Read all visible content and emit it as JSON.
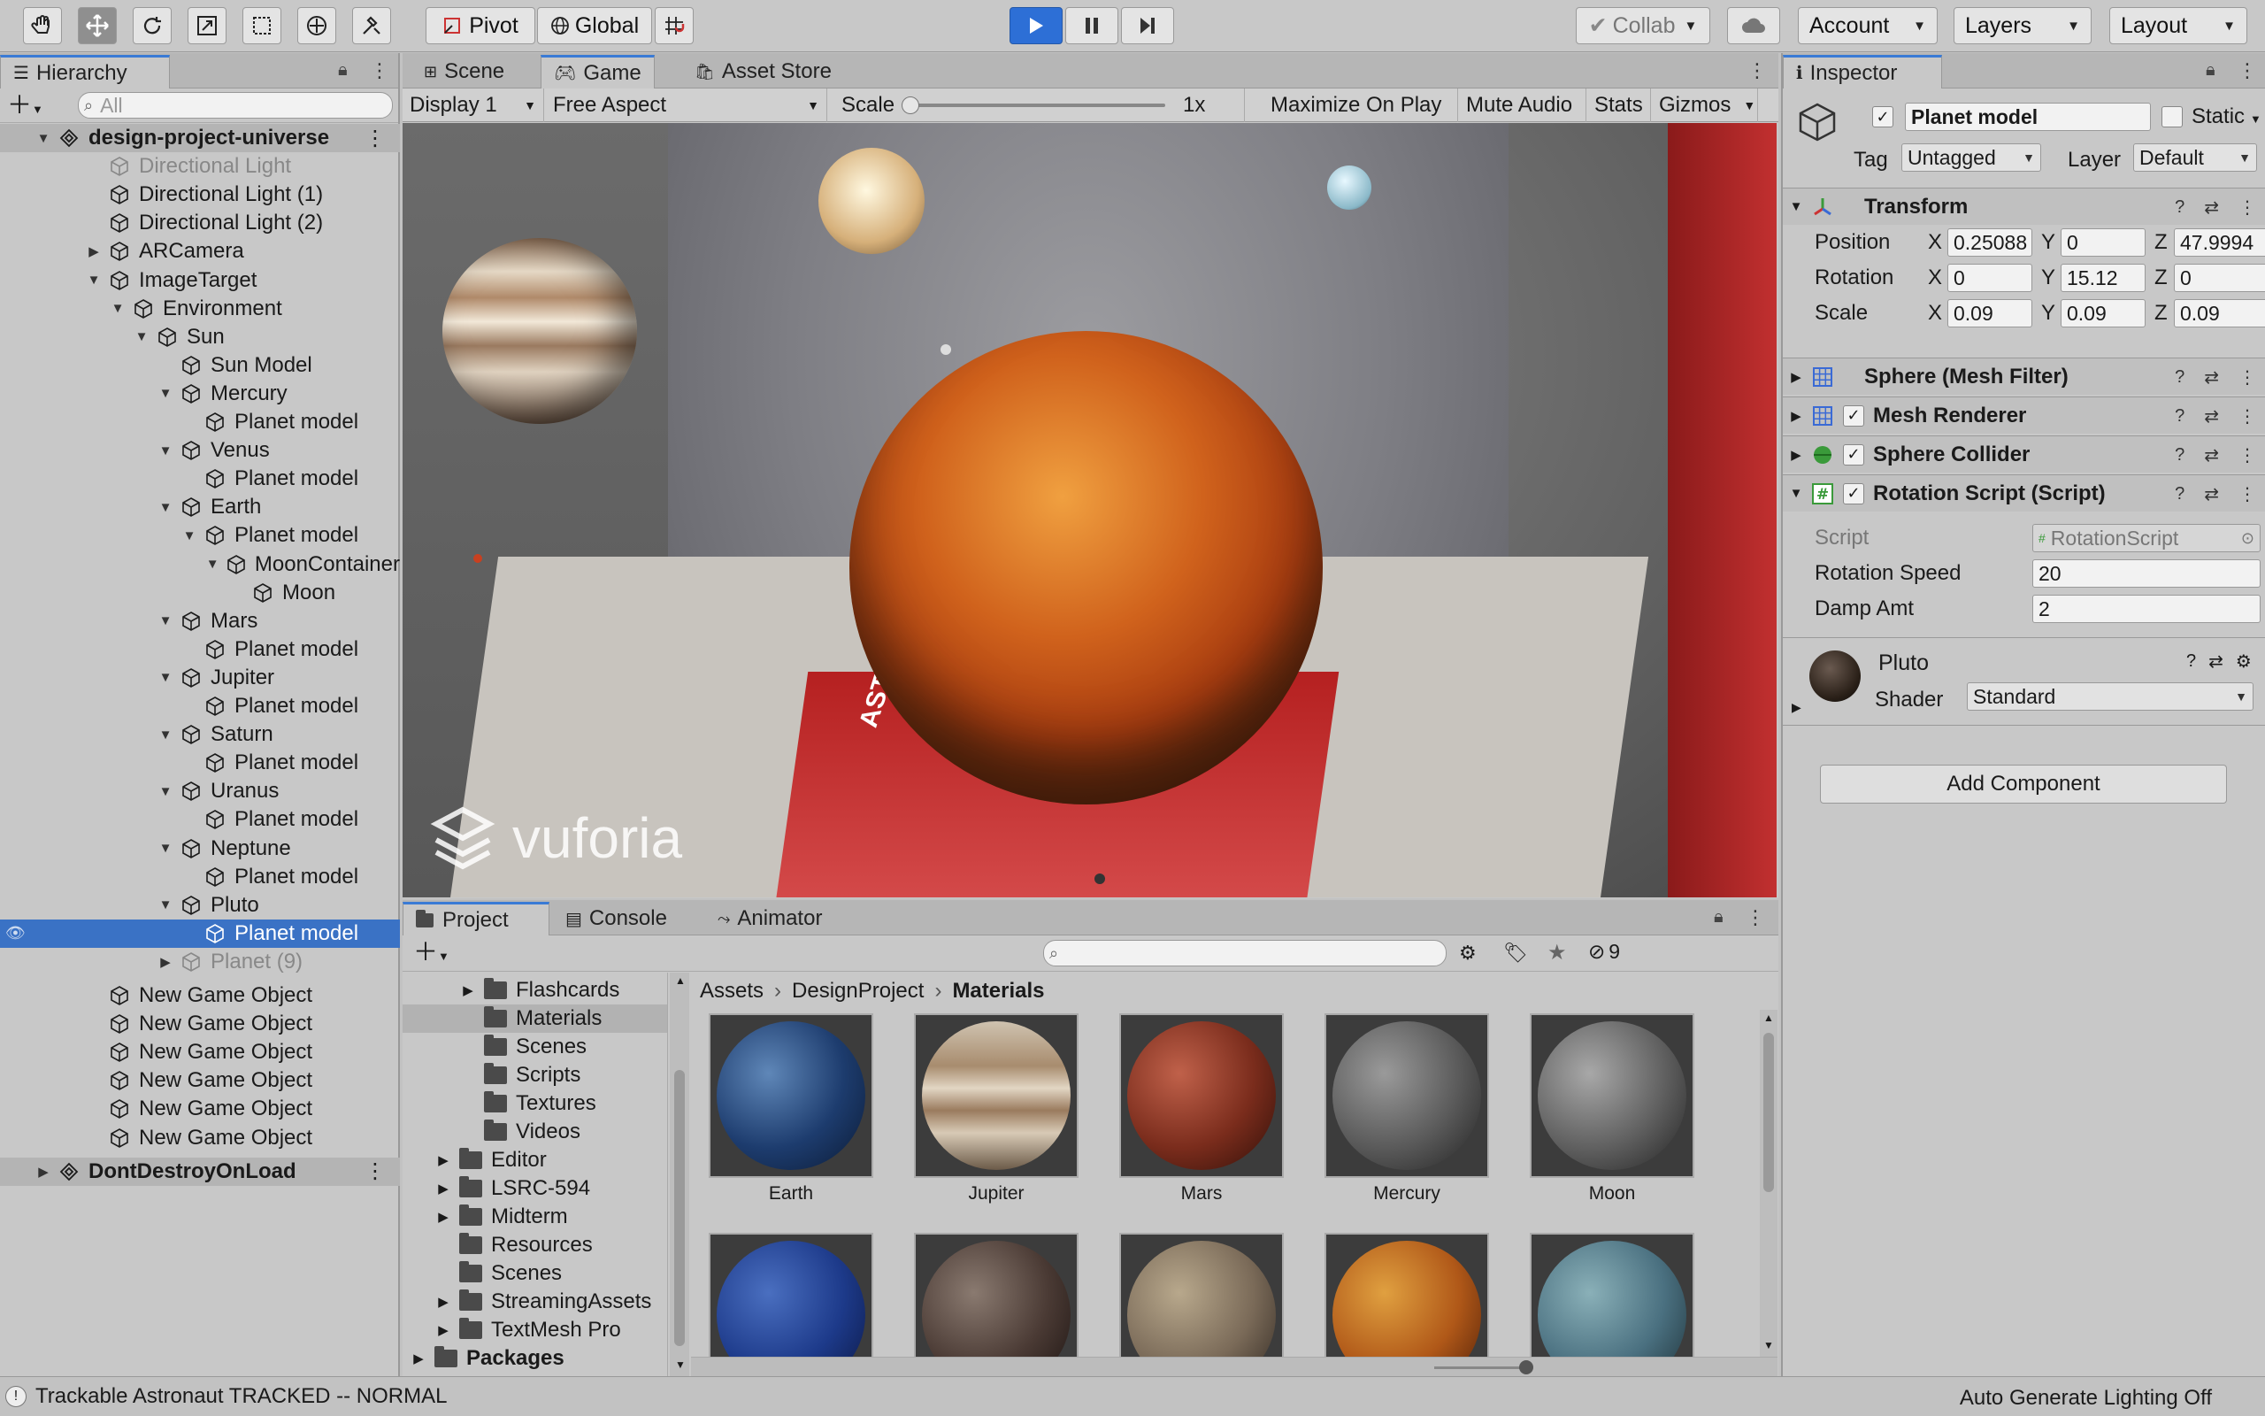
{
  "toolbar": {
    "pivot_label": "Pivot",
    "global_label": "Global",
    "collab_label": "Collab",
    "account_label": "Account",
    "layers_label": "Layers",
    "layout_label": "Layout"
  },
  "hierarchy": {
    "tab_label": "Hierarchy",
    "search_placeholder": "All",
    "items": [
      {
        "label": "design-project-universe",
        "indent": 0,
        "arrow": "▼",
        "icon": "unity-scene-icon",
        "style": "scene"
      },
      {
        "label": "Directional Light",
        "indent": 1,
        "arrow": "",
        "icon": "cube-icon",
        "style": "dim"
      },
      {
        "label": "Directional Light (1)",
        "indent": 1,
        "arrow": "",
        "icon": "cube-icon",
        "style": ""
      },
      {
        "label": "Directional Light (2)",
        "indent": 1,
        "arrow": "",
        "icon": "cube-icon",
        "style": ""
      },
      {
        "label": "ARCamera",
        "indent": 1,
        "arrow": "▶",
        "icon": "cube-icon",
        "style": ""
      },
      {
        "label": "ImageTarget",
        "indent": 1,
        "arrow": "▼",
        "icon": "cube-icon",
        "style": ""
      },
      {
        "label": "Environment",
        "indent": 2,
        "arrow": "▼",
        "icon": "cube-icon",
        "style": ""
      },
      {
        "label": "Sun",
        "indent": 3,
        "arrow": "▼",
        "icon": "cube-icon",
        "style": ""
      },
      {
        "label": "Sun Model",
        "indent": 4,
        "arrow": "",
        "icon": "cube-icon",
        "style": ""
      },
      {
        "label": "Mercury",
        "indent": 4,
        "arrow": "▼",
        "icon": "cube-icon",
        "style": ""
      },
      {
        "label": "Planet model",
        "indent": 5,
        "arrow": "",
        "icon": "cube-icon",
        "style": ""
      },
      {
        "label": "Venus",
        "indent": 4,
        "arrow": "▼",
        "icon": "cube-icon",
        "style": ""
      },
      {
        "label": "Planet model",
        "indent": 5,
        "arrow": "",
        "icon": "cube-icon",
        "style": ""
      },
      {
        "label": "Earth",
        "indent": 4,
        "arrow": "▼",
        "icon": "cube-icon",
        "style": ""
      },
      {
        "label": "Planet model",
        "indent": 5,
        "arrow": "▼",
        "icon": "cube-icon",
        "style": ""
      },
      {
        "label": "MoonContainer",
        "indent": 6,
        "arrow": "▼",
        "icon": "cube-icon",
        "style": ""
      },
      {
        "label": "Moon",
        "indent": 7,
        "arrow": "",
        "icon": "cube-icon",
        "style": ""
      },
      {
        "label": "Mars",
        "indent": 4,
        "arrow": "▼",
        "icon": "cube-icon",
        "style": ""
      },
      {
        "label": "Planet model",
        "indent": 5,
        "arrow": "",
        "icon": "cube-icon",
        "style": ""
      },
      {
        "label": "Jupiter",
        "indent": 4,
        "arrow": "▼",
        "icon": "cube-icon",
        "style": ""
      },
      {
        "label": "Planet model",
        "indent": 5,
        "arrow": "",
        "icon": "cube-icon",
        "style": ""
      },
      {
        "label": "Saturn",
        "indent": 4,
        "arrow": "▼",
        "icon": "cube-icon",
        "style": ""
      },
      {
        "label": "Planet model",
        "indent": 5,
        "arrow": "",
        "icon": "cube-icon",
        "style": ""
      },
      {
        "label": "Uranus",
        "indent": 4,
        "arrow": "▼",
        "icon": "cube-icon",
        "style": ""
      },
      {
        "label": "Planet model",
        "indent": 5,
        "arrow": "",
        "icon": "cube-icon",
        "style": ""
      },
      {
        "label": "Neptune",
        "indent": 4,
        "arrow": "▼",
        "icon": "cube-icon",
        "style": ""
      },
      {
        "label": "Planet model",
        "indent": 5,
        "arrow": "",
        "icon": "cube-icon",
        "style": ""
      },
      {
        "label": "Pluto",
        "indent": 4,
        "arrow": "▼",
        "icon": "cube-icon",
        "style": ""
      },
      {
        "label": "Planet model",
        "indent": 5,
        "arrow": "",
        "icon": "cube-icon",
        "style": "sel"
      },
      {
        "label": "Planet (9)",
        "indent": 4,
        "arrow": "▶",
        "icon": "cube-icon",
        "style": "dim"
      },
      {
        "label": "New Game Object",
        "indent": 1,
        "arrow": "",
        "icon": "cube-icon",
        "style": ""
      },
      {
        "label": "New Game Object",
        "indent": 1,
        "arrow": "",
        "icon": "cube-icon",
        "style": ""
      },
      {
        "label": "New Game Object",
        "indent": 1,
        "arrow": "",
        "icon": "cube-icon",
        "style": ""
      },
      {
        "label": "New Game Object",
        "indent": 1,
        "arrow": "",
        "icon": "cube-icon",
        "style": ""
      },
      {
        "label": "New Game Object",
        "indent": 1,
        "arrow": "",
        "icon": "cube-icon",
        "style": ""
      },
      {
        "label": "New Game Object",
        "indent": 1,
        "arrow": "",
        "icon": "cube-icon",
        "style": ""
      },
      {
        "label": "DontDestroyOnLoad",
        "indent": 0,
        "arrow": "▶",
        "icon": "unity-scene-icon",
        "style": "scene"
      }
    ]
  },
  "game": {
    "tabs": [
      "Scene",
      "Game",
      "Asset Store"
    ],
    "display": "Display 1",
    "aspect": "Free Aspect",
    "scale_label": "Scale",
    "scale_value": "1x",
    "maximize": "Maximize On Play",
    "mute": "Mute Audio",
    "stats": "Stats",
    "gizmos": "Gizmos",
    "watermark": "vuforia",
    "card_text": "ASTRONAUT"
  },
  "project": {
    "tabs": [
      "Project",
      "Console",
      "Animator"
    ],
    "badge_count": "9",
    "folders": [
      {
        "label": "Flashcards",
        "indent": 2,
        "arrow": "▶",
        "sel": false,
        "bold": false
      },
      {
        "label": "Materials",
        "indent": 2,
        "arrow": "",
        "sel": true,
        "bold": false
      },
      {
        "label": "Scenes",
        "indent": 2,
        "arrow": "",
        "sel": false,
        "bold": false
      },
      {
        "label": "Scripts",
        "indent": 2,
        "arrow": "",
        "sel": false,
        "bold": false
      },
      {
        "label": "Textures",
        "indent": 2,
        "arrow": "",
        "sel": false,
        "bold": false
      },
      {
        "label": "Videos",
        "indent": 2,
        "arrow": "",
        "sel": false,
        "bold": false
      },
      {
        "label": "Editor",
        "indent": 1,
        "arrow": "▶",
        "sel": false,
        "bold": false
      },
      {
        "label": "LSRC-594",
        "indent": 1,
        "arrow": "▶",
        "sel": false,
        "bold": false
      },
      {
        "label": "Midterm",
        "indent": 1,
        "arrow": "▶",
        "sel": false,
        "bold": false
      },
      {
        "label": "Resources",
        "indent": 1,
        "arrow": "",
        "sel": false,
        "bold": false
      },
      {
        "label": "Scenes",
        "indent": 1,
        "arrow": "",
        "sel": false,
        "bold": false
      },
      {
        "label": "StreamingAssets",
        "indent": 1,
        "arrow": "▶",
        "sel": false,
        "bold": false
      },
      {
        "label": "TextMesh Pro",
        "indent": 1,
        "arrow": "▶",
        "sel": false,
        "bold": false
      },
      {
        "label": "Packages",
        "indent": 0,
        "arrow": "▶",
        "sel": false,
        "bold": true
      }
    ],
    "breadcrumb": [
      "Assets",
      "DesignProject",
      "Materials"
    ],
    "assets": [
      {
        "name": "Earth",
        "color": "radial-gradient(circle at 35% 35%, #5f87b8, #1d3c6e 55%, #0b1a33)"
      },
      {
        "name": "Jupiter",
        "color": "linear-gradient(180deg, #cfc3b0 0%, #a88c6e 30%, #e2d6c4 45%, #9a7b5e 60%, #d8cab6 75%, #6b5a48 100%)"
      },
      {
        "name": "Mars",
        "color": "radial-gradient(circle at 35% 35%, #c0614a, #7a2c1c 55%, #2e0f08)"
      },
      {
        "name": "Mercury",
        "color": "radial-gradient(circle at 35% 35%, #9a9a9a, #5a5a5a 55%, #222)"
      },
      {
        "name": "Moon",
        "color": "radial-gradient(circle at 35% 35%, #a8a8a8, #606060 55%, #222)"
      },
      {
        "name": "",
        "color": "radial-gradient(circle at 35% 35%, #4a6fc0, #1d3a8a 55%, #0b1640)"
      },
      {
        "name": "",
        "color": "radial-gradient(circle at 35% 35%, #8a7a70, #4a3a34 55%, #1a1210)"
      },
      {
        "name": "",
        "color": "radial-gradient(circle at 35% 35%, #b8a88c, #7a6a58 55%, #2e2620)"
      },
      {
        "name": "",
        "color": "radial-gradient(circle at 35% 35%, #e0a040, #b05818 55%, #4a1c08)"
      },
      {
        "name": "",
        "color": "radial-gradient(circle at 35% 35%, #8ab0b8, #4a7080 55%, #1c2e34)"
      }
    ]
  },
  "inspector": {
    "tab_label": "Inspector",
    "object_name": "Planet model",
    "static_label": "Static",
    "tag_label": "Tag",
    "tag_value": "Untagged",
    "layer_label": "Layer",
    "layer_value": "Default",
    "transform": {
      "title": "Transform",
      "position_label": "Position",
      "rotation_label": "Rotation",
      "scale_label": "Scale",
      "position": [
        "0.25088",
        "0",
        "47.9994"
      ],
      "rotation": [
        "0",
        "15.12",
        "0"
      ],
      "scale": [
        "0.09",
        "0.09",
        "0.09"
      ]
    },
    "components": [
      "Sphere (Mesh Filter)",
      "Mesh Renderer",
      "Sphere Collider",
      "Rotation Script (Script)"
    ],
    "script": {
      "script_label": "Script",
      "script_value": "RotationScript",
      "speed_label": "Rotation Speed",
      "speed_value": "20",
      "damp_label": "Damp Amt",
      "damp_value": "2"
    },
    "material": {
      "name": "Pluto",
      "shader_label": "Shader",
      "shader_value": "Standard"
    },
    "add_component": "Add Component"
  },
  "status": {
    "message": "Trackable Astronaut TRACKED -- NORMAL",
    "lighting": "Auto Generate Lighting Off"
  },
  "colors": {
    "accent": "#3a72c5",
    "play": "#2d6fd6"
  }
}
